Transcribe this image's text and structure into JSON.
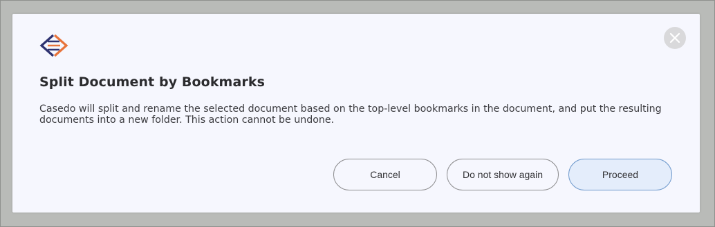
{
  "dialog": {
    "title": "Split Document by Bookmarks",
    "message": "Casedo will split and rename the selected document based on the top-level bookmarks in the document, and put the resulting documents into a new folder. This action cannot be undone.",
    "buttons": {
      "cancel": "Cancel",
      "dont_show": "Do not show again",
      "proceed": "Proceed"
    },
    "icons": {
      "logo": "casedo-logo-icon",
      "close": "close-icon"
    },
    "colors": {
      "logo_navy": "#2e3270",
      "logo_orange": "#e8743b",
      "proceed_bg": "#e4edfb",
      "proceed_border": "#6e99cc"
    }
  }
}
